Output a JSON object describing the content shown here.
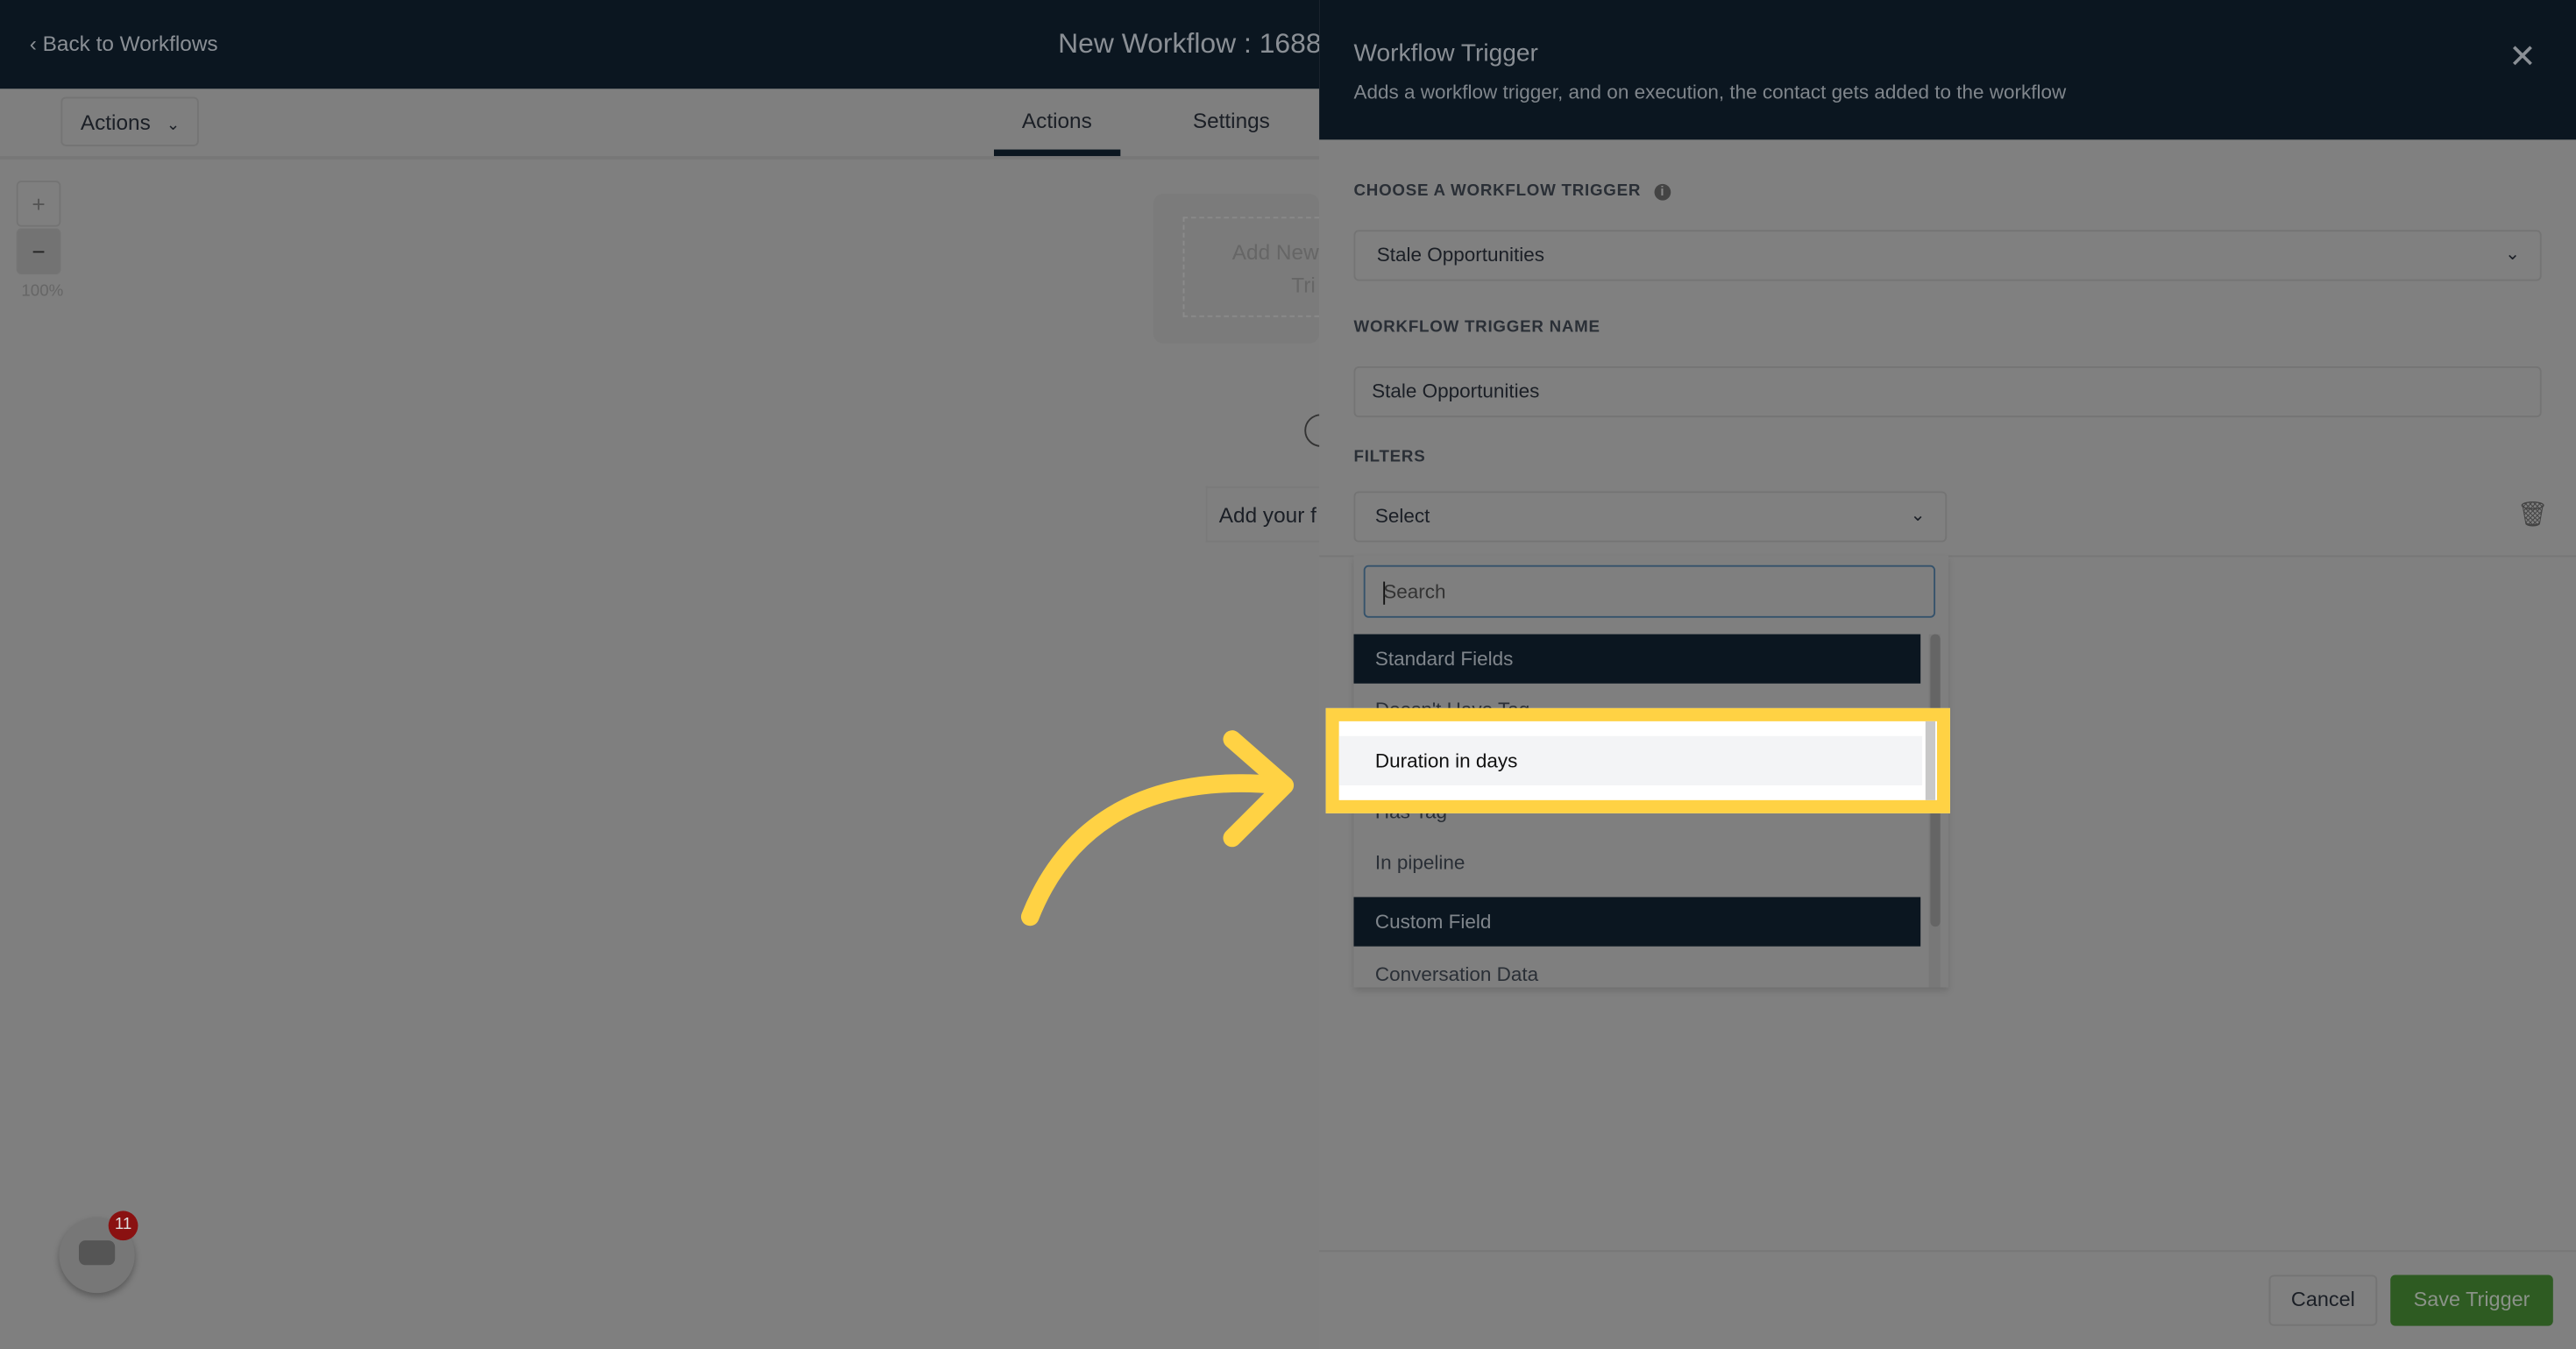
{
  "header": {
    "back_label": "Back to Workflows",
    "workflow_title": "New Workflow : 1688"
  },
  "toolbar": {
    "actions_dropdown": "Actions",
    "tabs": [
      {
        "label": "Actions",
        "active": true
      },
      {
        "label": "Settings",
        "active": false
      }
    ]
  },
  "canvas": {
    "zoom_in": "+",
    "zoom_out": "−",
    "zoom_level": "100%",
    "trigger_card_line1": "Add New",
    "trigger_card_line2": "Tri",
    "add_action": "Add your f"
  },
  "chat": {
    "badge_count": "11"
  },
  "panel": {
    "title": "Workflow Trigger",
    "subtitle": "Adds a workflow trigger, and on execution, the contact gets added to the workflow",
    "trigger_label": "CHOOSE A WORKFLOW TRIGGER",
    "trigger_value": "Stale Opportunities",
    "name_label": "WORKFLOW TRIGGER NAME",
    "name_value": "Stale Opportunities",
    "filters_label": "FILTERS",
    "filter_select": "Select",
    "dropdown": {
      "search_placeholder": "Search",
      "groups": [
        {
          "label": "Standard Fields",
          "options": [
            "Doesn't Have Tag",
            "Duration in days",
            "Has Tag",
            "In pipeline"
          ]
        },
        {
          "label": "Custom Field",
          "options": [
            "Conversation Data"
          ]
        }
      ],
      "highlighted_option": "Duration in days"
    },
    "cancel_label": "Cancel",
    "save_label": "Save Trigger"
  },
  "colors": {
    "header_bg": "#0b1620",
    "highlight": "#ffd244",
    "save_button": "#2e5b22",
    "annotation_arrow": "#ffd244"
  }
}
